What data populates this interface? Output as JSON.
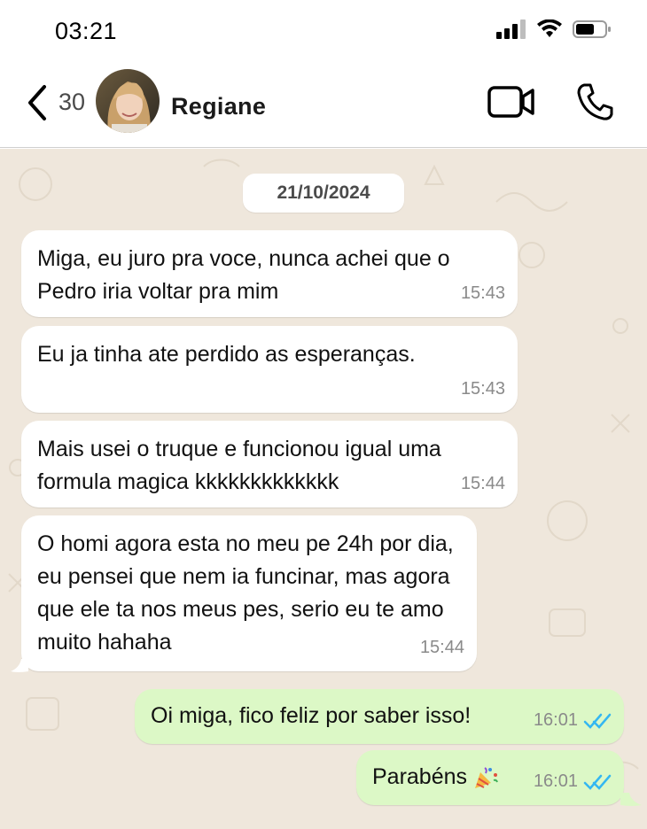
{
  "status_bar": {
    "time": "03:21"
  },
  "header": {
    "back_count": "30",
    "contact_name": "Regiane"
  },
  "chat": {
    "date": "21/10/2024",
    "messages": [
      {
        "direction": "incoming",
        "text": "Miga, eu juro pra voce, nunca achei que o Pedro iria voltar pra mim",
        "time": "15:43"
      },
      {
        "direction": "incoming",
        "text": "Eu ja tinha ate perdido as esperanças.",
        "time": "15:43"
      },
      {
        "direction": "incoming",
        "text": "Mais usei o truque e funcionou igual uma formula magica kkkkkkkkkkkkk",
        "time": "15:44"
      },
      {
        "direction": "incoming",
        "text": "O homi agora esta no meu pe 24h por dia, eu pensei que nem ia funcinar, mas agora que ele ta nos meus pes, serio eu te amo muito hahaha",
        "time": "15:44"
      },
      {
        "direction": "outgoing",
        "text": "Oi miga, fico feliz por saber isso!",
        "time": "16:01",
        "status": "read"
      },
      {
        "direction": "outgoing",
        "text": "Parabéns",
        "emoji": "party-popper",
        "time": "16:01",
        "status": "read"
      }
    ]
  },
  "colors": {
    "incoming_bubble": "#ffffff",
    "outgoing_bubble": "#dcf8c6",
    "chat_background": "#efe7dc",
    "read_ticks": "#34b7f1"
  }
}
